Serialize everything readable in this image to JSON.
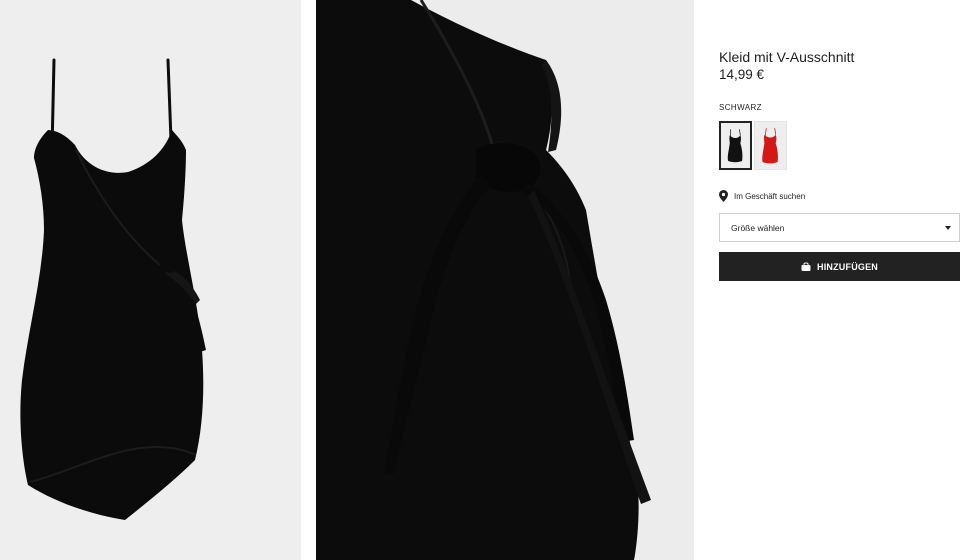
{
  "product": {
    "title": "Kleid mit V-Ausschnitt",
    "price": "14,99 €",
    "color_name": "SCHWARZ"
  },
  "images": {
    "main": {
      "alt": "black-wrap-dress-full",
      "background": "#eeeeee"
    },
    "detail": {
      "alt": "black-wrap-dress-tie-detail",
      "background": "#ececec"
    }
  },
  "swatches": [
    {
      "color": "#111111",
      "icon": "dress-black",
      "selected": true
    },
    {
      "color": "#d41818",
      "icon": "dress-red",
      "selected": false
    }
  ],
  "store": {
    "icon": "location-pin-icon",
    "label": "Im Geschäft suchen"
  },
  "size_select": {
    "selected": "Größe wählen",
    "icon": "caret-down-icon"
  },
  "add_button": {
    "label": "HINZUFÜGEN",
    "icon": "bag-icon",
    "background": "#222222"
  }
}
